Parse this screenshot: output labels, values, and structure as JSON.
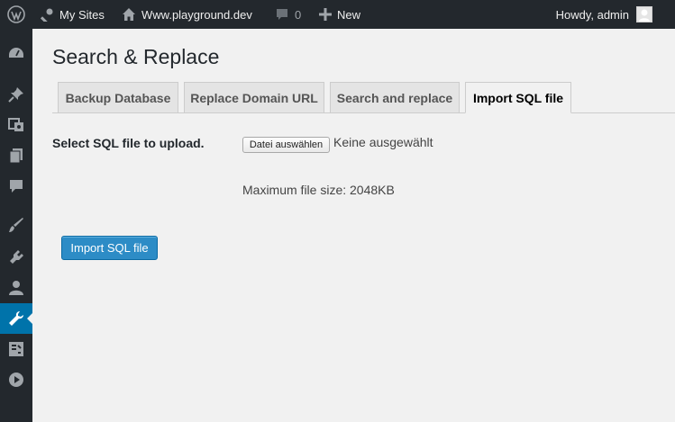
{
  "adminbar": {
    "my_sites": "My Sites",
    "site_name": "Www.playground.dev",
    "comments_count": "0",
    "new_label": "New",
    "greeting": "Howdy, admin"
  },
  "sidebar": {
    "items": [
      {
        "icon": "dashboard-icon"
      },
      {
        "icon": "pin-icon"
      },
      {
        "icon": "media-icon"
      },
      {
        "icon": "pages-icon"
      },
      {
        "icon": "comments-icon"
      },
      {
        "icon": "appearance-icon"
      },
      {
        "icon": "plugins-icon"
      },
      {
        "icon": "users-icon"
      },
      {
        "icon": "tools-icon",
        "active": true
      },
      {
        "icon": "settings-icon"
      },
      {
        "icon": "play-icon"
      }
    ]
  },
  "page": {
    "title": "Search & Replace",
    "tabs": [
      {
        "label": "Backup Database"
      },
      {
        "label": "Replace Domain URL"
      },
      {
        "label": "Search and replace"
      },
      {
        "label": "Import SQL file",
        "active": true
      }
    ],
    "upload_label": "Select SQL file to upload.",
    "file_button": "Datei auswählen",
    "file_status": "Keine ausgewählt",
    "max_size": "Maximum file size: 2048KB",
    "submit_label": "Import SQL file"
  },
  "colors": {
    "adminbar_bg": "#23282d",
    "accent": "#0073aa",
    "button_primary": "#2d8cc6",
    "page_bg": "#f1f1f1"
  }
}
